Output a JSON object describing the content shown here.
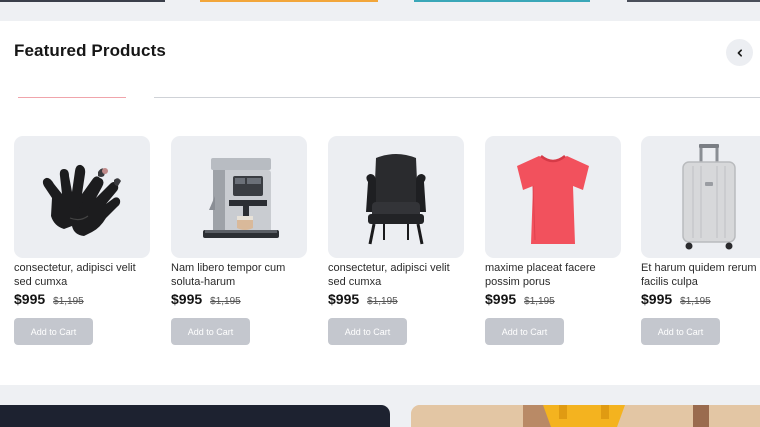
{
  "section": {
    "title": "Featured Products",
    "nav_prev_icon": "chevron-left-icon"
  },
  "products": [
    {
      "name": "consectetur, adipisci velit sed cumxa",
      "price": "$995",
      "old_price": "$1,195",
      "cart_label": "Add to Cart",
      "image": "gloves"
    },
    {
      "name": "Nam libero tempor cum soluta-harum",
      "price": "$995",
      "old_price": "$1,195",
      "cart_label": "Add to Cart",
      "image": "coffee-machine"
    },
    {
      "name": "consectetur, adipisci velit sed cumxa",
      "price": "$995",
      "old_price": "$1,195",
      "cart_label": "Add to Cart",
      "image": "armchair"
    },
    {
      "name": "maxime placeat facere possim porus",
      "price": "$995",
      "old_price": "$1,195",
      "cart_label": "Add to Cart",
      "image": "t-shirt"
    },
    {
      "name": "Et harum quidem rerum facilis culpa",
      "price": "$995",
      "old_price": "$1,195",
      "cart_label": "Add to Cart",
      "image": "suitcase"
    }
  ],
  "colors": {
    "tab_active": "#f0a4ab",
    "button": "#c4c7ce",
    "card_bg": "#eceef2",
    "tshirt": "#f2515d"
  }
}
